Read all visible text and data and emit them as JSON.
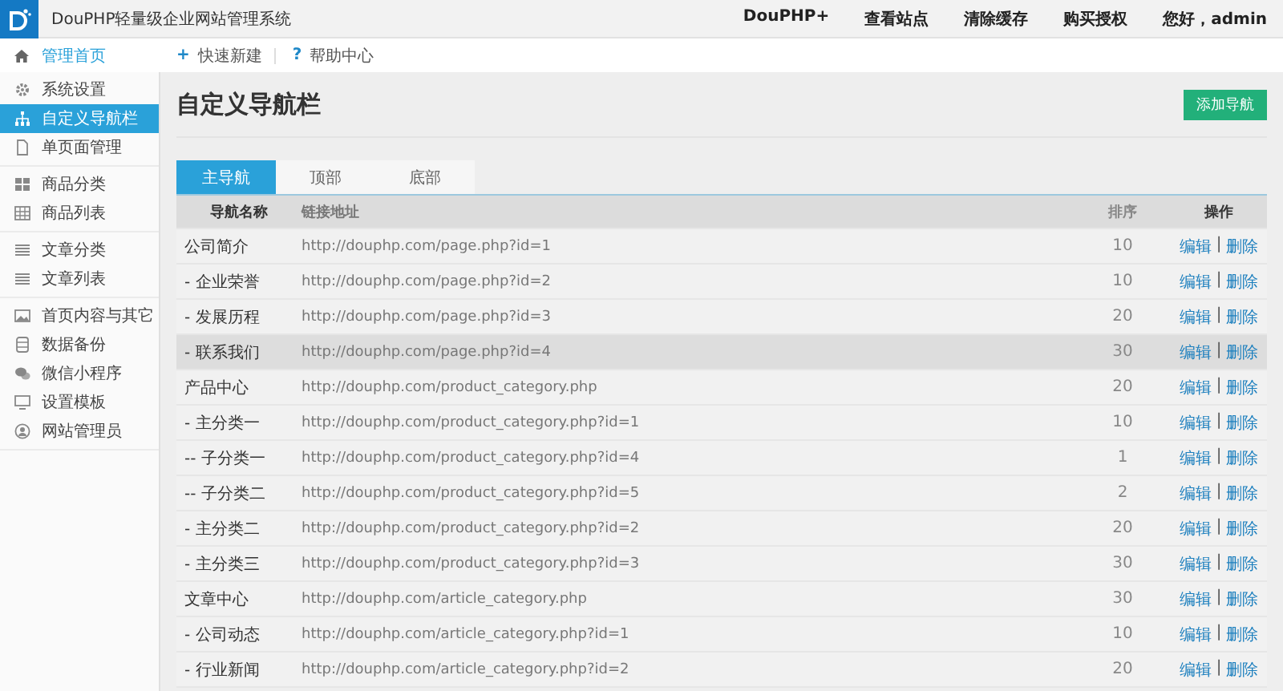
{
  "header": {
    "title": "DouPHP轻量级企业网站管理系统",
    "links": [
      {
        "label": "DouPHP+"
      },
      {
        "label": "查看站点"
      },
      {
        "label": "清除缓存"
      },
      {
        "label": "购买授权"
      },
      {
        "label": "您好，admin"
      }
    ]
  },
  "home": {
    "label": "管理首页"
  },
  "quick_links": [
    {
      "icon": "+",
      "label": "快速新建"
    },
    {
      "icon": "?",
      "label": "帮助中心"
    }
  ],
  "sidebar": {
    "groups": [
      {
        "items": [
          {
            "label": "系统设置",
            "selected": false
          },
          {
            "label": "自定义导航栏",
            "selected": true
          },
          {
            "label": "单页面管理",
            "selected": false
          }
        ]
      },
      {
        "items": [
          {
            "label": "商品分类",
            "selected": false
          },
          {
            "label": "商品列表",
            "selected": false
          }
        ]
      },
      {
        "items": [
          {
            "label": "文章分类",
            "selected": false
          },
          {
            "label": "文章列表",
            "selected": false
          }
        ]
      },
      {
        "items": [
          {
            "label": "首页内容与其它",
            "selected": false
          },
          {
            "label": "数据备份",
            "selected": false
          },
          {
            "label": "微信小程序",
            "selected": false
          },
          {
            "label": "设置模板",
            "selected": false
          },
          {
            "label": "网站管理员",
            "selected": false
          }
        ]
      }
    ]
  },
  "page_title": "自定义导航栏",
  "add_button": "添加导航",
  "tabs": [
    {
      "label": "主导航",
      "selected": true
    },
    {
      "label": "顶部",
      "selected": false
    },
    {
      "label": "底部",
      "selected": false
    }
  ],
  "table": {
    "columns": [
      "导航名称",
      "链接地址",
      "排序",
      "操作"
    ],
    "rows": [
      {
        "name": "公司简介",
        "url": "http://douphp.com/page.php?id=1",
        "order": "10",
        "highlighted": false,
        "actions": [
          "编辑",
          "删除"
        ],
        "separator": "|"
      },
      {
        "name": "- 企业荣誉",
        "url": "http://douphp.com/page.php?id=2",
        "order": "10",
        "highlighted": false,
        "actions": [
          "编辑",
          "删除"
        ],
        "separator": "|"
      },
      {
        "name": "- 发展历程",
        "url": "http://douphp.com/page.php?id=3",
        "order": "20",
        "highlighted": false,
        "actions": [
          "编辑",
          "删除"
        ],
        "separator": "|"
      },
      {
        "name": "- 联系我们",
        "url": "http://douphp.com/page.php?id=4",
        "order": "30",
        "highlighted": true,
        "actions": [
          "编辑",
          "删除"
        ],
        "separator": "|"
      },
      {
        "name": "产品中心",
        "url": "http://douphp.com/product_category.php",
        "order": "20",
        "highlighted": false,
        "actions": [
          "编辑",
          "删除"
        ],
        "separator": "|"
      },
      {
        "name": "- 主分类一",
        "url": "http://douphp.com/product_category.php?id=1",
        "order": "10",
        "highlighted": false,
        "actions": [
          "编辑",
          "删除"
        ],
        "separator": "|"
      },
      {
        "name": "-- 子分类一",
        "url": "http://douphp.com/product_category.php?id=4",
        "order": "1",
        "highlighted": false,
        "actions": [
          "编辑",
          "删除"
        ],
        "separator": "|"
      },
      {
        "name": "-- 子分类二",
        "url": "http://douphp.com/product_category.php?id=5",
        "order": "2",
        "highlighted": false,
        "actions": [
          "编辑",
          "删除"
        ],
        "separator": "|"
      },
      {
        "name": "- 主分类二",
        "url": "http://douphp.com/product_category.php?id=2",
        "order": "20",
        "highlighted": false,
        "actions": [
          "编辑",
          "删除"
        ],
        "separator": "|"
      },
      {
        "name": "- 主分类三",
        "url": "http://douphp.com/product_category.php?id=3",
        "order": "30",
        "highlighted": false,
        "actions": [
          "编辑",
          "删除"
        ],
        "separator": "|"
      },
      {
        "name": "文章中心",
        "url": "http://douphp.com/article_category.php",
        "order": "30",
        "highlighted": false,
        "actions": [
          "编辑",
          "删除"
        ],
        "separator": "|"
      },
      {
        "name": "- 公司动态",
        "url": "http://douphp.com/article_category.php?id=1",
        "order": "10",
        "highlighted": false,
        "actions": [
          "编辑",
          "删除"
        ],
        "separator": "|"
      },
      {
        "name": "- 行业新闻",
        "url": "http://douphp.com/article_category.php?id=2",
        "order": "20",
        "highlighted": false,
        "actions": [
          "编辑",
          "删除"
        ],
        "separator": "|"
      }
    ]
  }
}
